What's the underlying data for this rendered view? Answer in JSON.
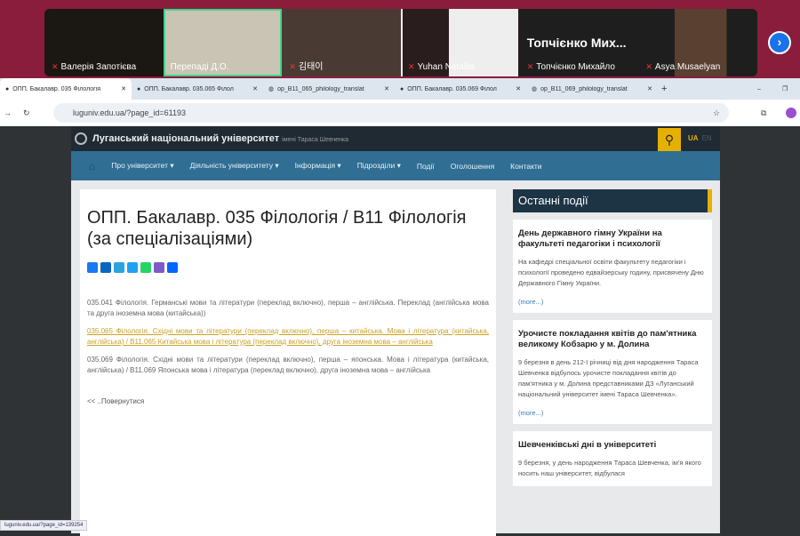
{
  "meeting": {
    "participants": [
      {
        "name": "Валерія Запотієва",
        "muted": true
      },
      {
        "name": "Перепаді Д.О.",
        "muted": false,
        "active": true
      },
      {
        "name": "김태이",
        "muted": true
      },
      {
        "name": "Yuhan Nataliia",
        "muted": true
      },
      {
        "name": "Топчієнко Михайло",
        "muted": true,
        "big_label": "Топчієнко Мих..."
      },
      {
        "name": "Asya Musaelyan",
        "muted": true
      }
    ]
  },
  "browser": {
    "tabs": [
      "ОПП. Бакалавр. 035 Філологія",
      "ОПП. Бакалавр. 035.065 Філол",
      "op_B11_065_philology_translat",
      "ОПП. Бакалавр. 035.069 Філол",
      "op_B11_069_philology_translat"
    ],
    "url": "luguniv.edu.ua/?page_id=61193",
    "status_url": "luguniv.edu.ua/?page_id=139254"
  },
  "site": {
    "title": "Луганський національний університет",
    "subtitle": "імені Тараса Шевченка",
    "lang_active": "UA",
    "lang_other": "EN",
    "nav": [
      "Про університет ▾",
      "Діяльність університету ▾",
      "Інформація ▾",
      "Підрозділи ▾",
      "Події",
      "Оголошення",
      "Контакти"
    ]
  },
  "main": {
    "title": "ОПП. Бакалавр. 035 Філологія / В11 Філологія (за спеціалізаціями)",
    "items": [
      "035.041 Філологія. Германські мови та літератури (переклад включно), перша – англійська. Переклад (англійська мова та друга іноземна мова (китайська))",
      "035.065 Філологія. Східні мови та літератури (переклад включно), перша – китайська. Мова і література (китайська, англійська) / В11.065 Китайська мова і література (переклад включно), друга іноземна мова – англійська",
      "035.069 Філологія. Східні мови та літератури (переклад включно), перша – японська. Мова і література (китайська, англійська) / В11.069 Японська мова і література (переклад включно), друга іноземна мова – англійська"
    ],
    "back": "<< ..Повернутися"
  },
  "sidebar": {
    "title": "Останні події",
    "more": "(more...)",
    "events": [
      {
        "title": "День державного гімну України на факультеті педагогіки і психології",
        "text": "На кафедрі спеціальної освіти факультету педагогіки і психології проведено едвайзерську годину, присвячену Дню Державного Гімну України."
      },
      {
        "title": "Урочисте покладання квітів до пам'ятника великому Кобзарю  у м. Долина",
        "text": "9 березня в день 212-ї річниці від дня народження Тараса Шевченка відбулось урочисте покладання квітів до пам'ятника  у м. Долина представниками ДЗ «Луганський національний університет імені Тараса Шевченка»."
      },
      {
        "title": "Шевченківські дні в університеті",
        "text": "9 березня, у день народження Тараса Шевченка, ім'я якого носить наш університет, відбулася"
      }
    ]
  }
}
